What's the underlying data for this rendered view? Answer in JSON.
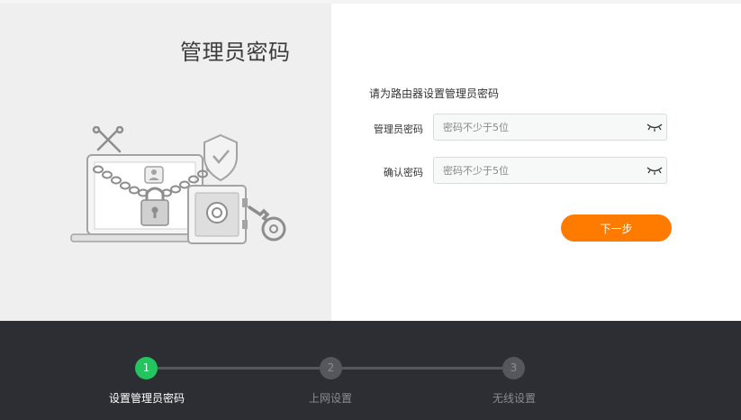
{
  "left": {
    "title": "管理员密码",
    "illustration": {
      "icons": [
        "tools-icon",
        "laptop-icon",
        "user-icon",
        "chain-icon",
        "padlock-icon",
        "shield-check-icon",
        "safe-icon",
        "key-icon"
      ]
    }
  },
  "form": {
    "heading": "请为路由器设置管理员密码",
    "fields": [
      {
        "label": "管理员密码",
        "value": "",
        "placeholder": "密码不少于5位",
        "icon": "eye-closed-icon"
      },
      {
        "label": "确认密码",
        "value": "",
        "placeholder": "密码不少于5位",
        "icon": "eye-closed-icon"
      }
    ],
    "next_label": "下一步"
  },
  "steps": [
    {
      "number": "1",
      "label": "设置管理员密码",
      "active": true
    },
    {
      "number": "2",
      "label": "上网设置",
      "active": false
    },
    {
      "number": "3",
      "label": "无线设置",
      "active": false
    }
  ],
  "colors": {
    "accent": "#ff7b00",
    "step_active": "#22c55e",
    "footer_bg": "#2c2e33",
    "left_bg": "#efefef"
  }
}
